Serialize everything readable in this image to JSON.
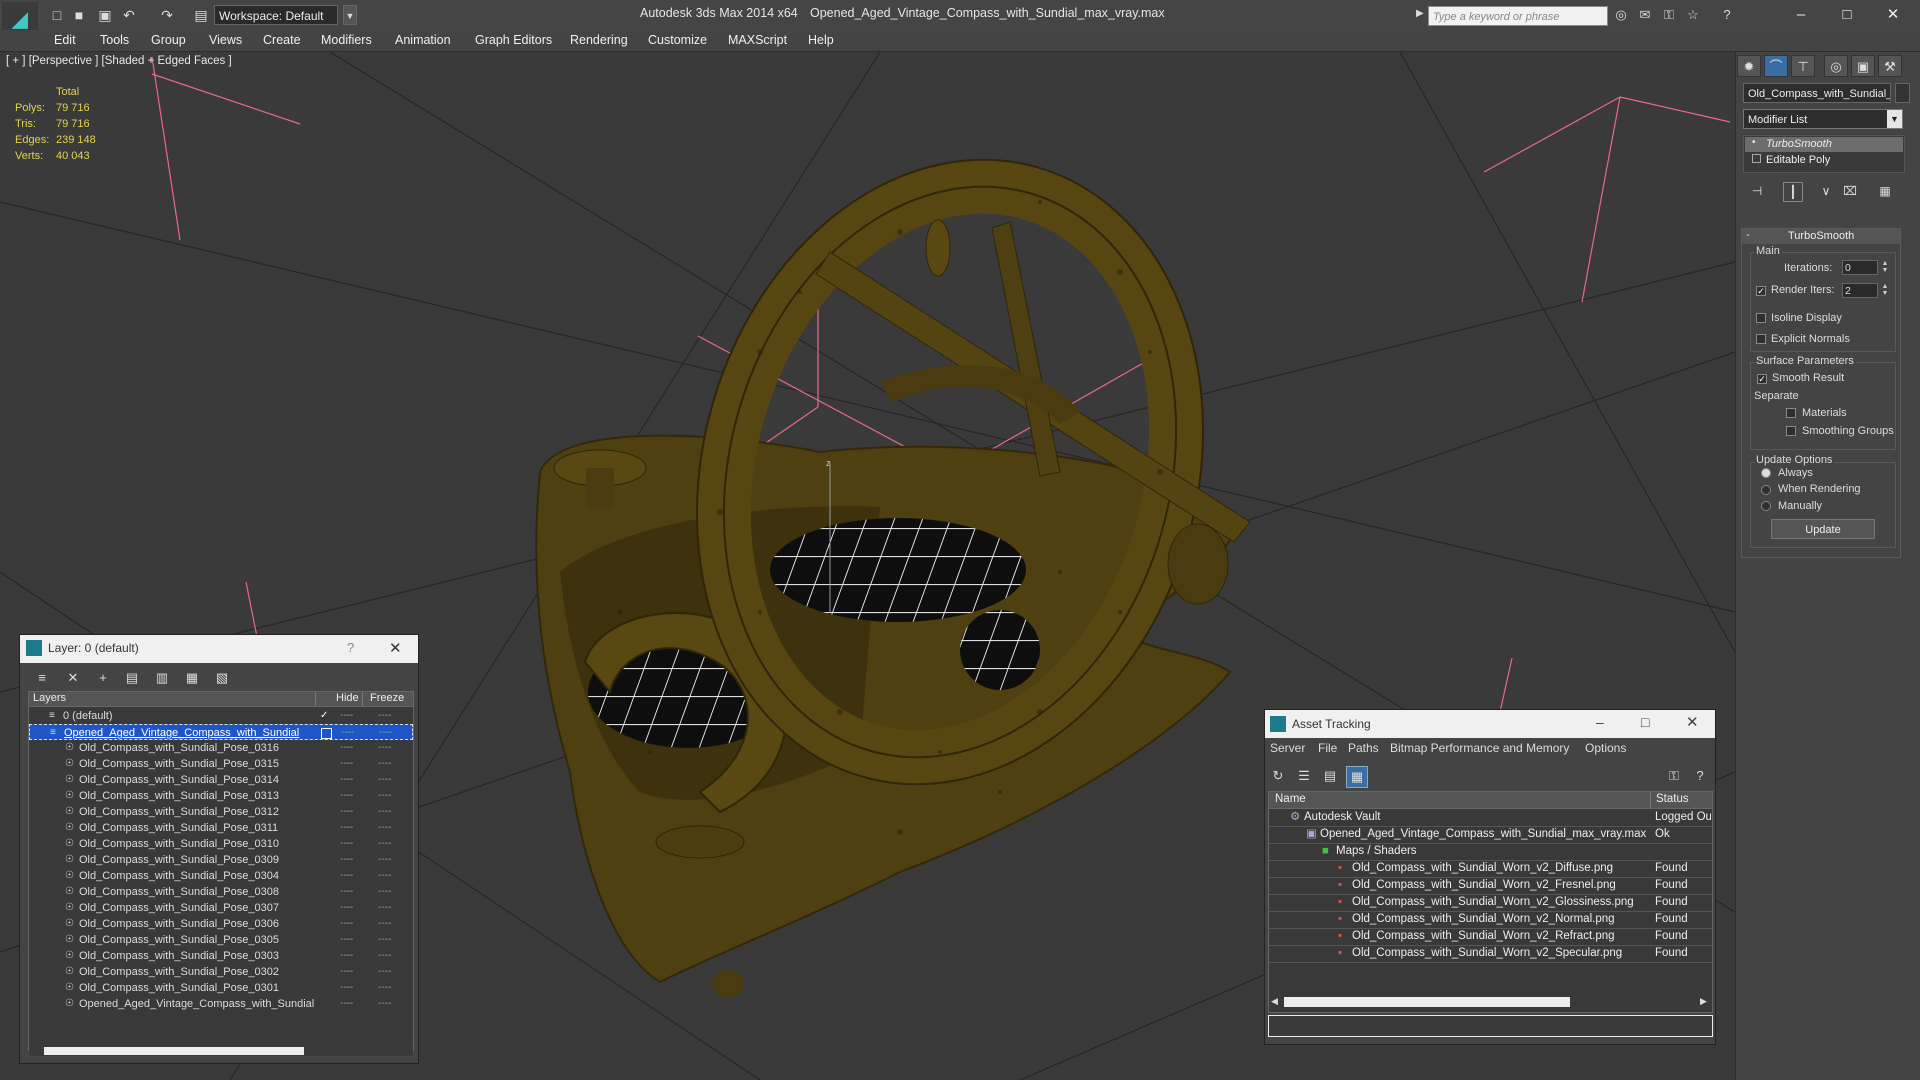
{
  "app": {
    "title": "Autodesk 3ds Max  2014 x64",
    "file": "Opened_Aged_Vintage_Compass_with_Sundial_max_vray.max",
    "workspace": "Workspace: Default",
    "search_placeholder": "Type a keyword or phrase"
  },
  "menu": [
    "Edit",
    "Tools",
    "Group",
    "Views",
    "Create",
    "Modifiers",
    "Animation",
    "Graph Editors",
    "Rendering",
    "Customize",
    "MAXScript",
    "Help"
  ],
  "viewport": {
    "label": "[ + ] [Perspective ] [Shaded + Edged Faces ]",
    "stats": {
      "header": "Total",
      "rows": [
        {
          "label": "Polys:",
          "value": "79 716"
        },
        {
          "label": "Tris:",
          "value": "79 716"
        },
        {
          "label": "Edges:",
          "value": "239 148"
        },
        {
          "label": "Verts:",
          "value": "40 043"
        }
      ]
    },
    "gizmo_axis": "z"
  },
  "command_panel": {
    "object_name": "Old_Compass_with_Sundial_F",
    "modifier_list": "Modifier List",
    "stack": [
      "TurboSmooth",
      "Editable Poly"
    ],
    "rollout_title": "TurboSmooth",
    "main_label": "Main",
    "iterations_label": "Iterations:",
    "iterations_value": "0",
    "render_iters_label": "Render Iters:",
    "render_iters_value": "2",
    "isoline": "Isoline Display",
    "explicit_normals": "Explicit Normals",
    "surface_params": "Surface Parameters",
    "smooth_result": "Smooth Result",
    "separate": "Separate",
    "materials": "Materials",
    "smoothing_groups": "Smoothing Groups",
    "update_options": "Update Options",
    "always": "Always",
    "when_rendering": "When Rendering",
    "manually": "Manually",
    "update_btn": "Update"
  },
  "layer_window": {
    "title": "Layer: 0 (default)",
    "help": "?",
    "columns": [
      "Layers",
      "Hide",
      "Freeze"
    ],
    "rows": [
      "0 (default)",
      "Opened_Aged_Vintage_Compass_with_Sundial",
      "Old_Compass_with_Sundial_Pose_0316",
      "Old_Compass_with_Sundial_Pose_0315",
      "Old_Compass_with_Sundial_Pose_0314",
      "Old_Compass_with_Sundial_Pose_0313",
      "Old_Compass_with_Sundial_Pose_0312",
      "Old_Compass_with_Sundial_Pose_0311",
      "Old_Compass_with_Sundial_Pose_0310",
      "Old_Compass_with_Sundial_Pose_0309",
      "Old_Compass_with_Sundial_Pose_0304",
      "Old_Compass_with_Sundial_Pose_0308",
      "Old_Compass_with_Sundial_Pose_0307",
      "Old_Compass_with_Sundial_Pose_0306",
      "Old_Compass_with_Sundial_Pose_0305",
      "Old_Compass_with_Sundial_Pose_0303",
      "Old_Compass_with_Sundial_Pose_0302",
      "Old_Compass_with_Sundial_Pose_0301",
      "Opened_Aged_Vintage_Compass_with_Sundial"
    ],
    "dash": "----"
  },
  "asset_window": {
    "title": "Asset Tracking",
    "menu": [
      "Server",
      "File",
      "Paths",
      "Bitmap Performance and Memory",
      "Options"
    ],
    "columns": [
      "Name",
      "Status"
    ],
    "rows": [
      {
        "name": "Autodesk Vault",
        "status": "Logged Ou"
      },
      {
        "name": "Opened_Aged_Vintage_Compass_with_Sundial_max_vray.max",
        "status": "Ok"
      },
      {
        "name": "Maps / Shaders",
        "status": ""
      },
      {
        "name": "Old_Compass_with_Sundial_Worn_v2_Diffuse.png",
        "status": "Found"
      },
      {
        "name": "Old_Compass_with_Sundial_Worn_v2_Fresnel.png",
        "status": "Found"
      },
      {
        "name": "Old_Compass_with_Sundial_Worn_v2_Glossiness.png",
        "status": "Found"
      },
      {
        "name": "Old_Compass_with_Sundial_Worn_v2_Normal.png",
        "status": "Found"
      },
      {
        "name": "Old_Compass_with_Sundial_Worn_v2_Refract.png",
        "status": "Found"
      },
      {
        "name": "Old_Compass_with_Sundial_Worn_v2_Specular.png",
        "status": "Found"
      }
    ]
  },
  "colors": {
    "stat_yellow": "#e4d44c",
    "selection_blue": "#1e56c8",
    "brass": "#5a4812",
    "gizmo_pink": "#e86a86"
  }
}
